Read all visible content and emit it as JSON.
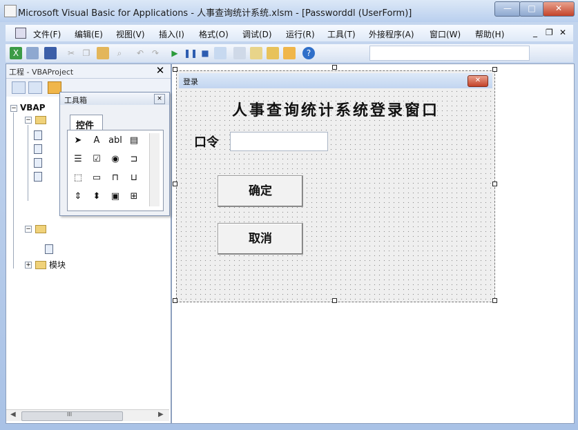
{
  "window": {
    "title": "Microsoft Visual Basic for Applications - 人事查询统计系统.xlsm - [Passworddl (UserForm)]",
    "minimize_label": "—",
    "maximize_label": "□",
    "close_label": "✕"
  },
  "menubar": {
    "items": [
      "文件(F)",
      "编辑(E)",
      "视图(V)",
      "插入(I)",
      "格式(O)",
      "调试(D)",
      "运行(R)",
      "工具(T)",
      "外接程序(A)",
      "窗口(W)",
      "帮助(H)"
    ],
    "mdi_minimize": "_",
    "mdi_restore": "❐",
    "mdi_close": "✕"
  },
  "toolbar": {
    "icons": [
      "excel-icon",
      "insert-userform-icon",
      "save-icon",
      "cut-icon",
      "copy-icon",
      "paste-icon",
      "find-icon",
      "undo-icon",
      "redo-icon",
      "run-icon",
      "break-icon",
      "reset-icon",
      "design-mode-icon",
      "project-explorer-icon",
      "properties-icon",
      "object-browser-icon",
      "toolbox-icon",
      "help-icon"
    ]
  },
  "project_pane": {
    "title": "工程 - VBAProject",
    "close_label": "✕",
    "tree": {
      "root_label": "VBAP",
      "modules_label": "模块"
    },
    "scroll_mid": "III"
  },
  "toolbox": {
    "title": "工具箱",
    "close_label": "×",
    "tab_label": "控件",
    "tools": [
      "pointer-tool",
      "label-tool",
      "textbox-tool",
      "combobox-tool",
      "listbox-tool",
      "checkbox-tool",
      "optionbutton-tool",
      "togglebutton-tool",
      "frame-tool",
      "commandbutton-tool",
      "tabstrip-tool",
      "multipage-tool",
      "scrollbar-tool",
      "spinbutton-tool",
      "image-tool",
      "refedit-tool"
    ],
    "tool_glyphs": [
      "➤",
      "A",
      "abl",
      "▤",
      "☰",
      "☑",
      "◉",
      "⊐",
      "⬚",
      "▭",
      "⊓",
      "⊔",
      "⇕",
      "⬍",
      "▣",
      "⊞"
    ]
  },
  "userform": {
    "caption": "登录",
    "close_label": "✕",
    "heading": "人事查询统计系统登录窗口",
    "password_label": "口令",
    "password_value": "",
    "ok_label": "确定",
    "cancel_label": "取消"
  }
}
